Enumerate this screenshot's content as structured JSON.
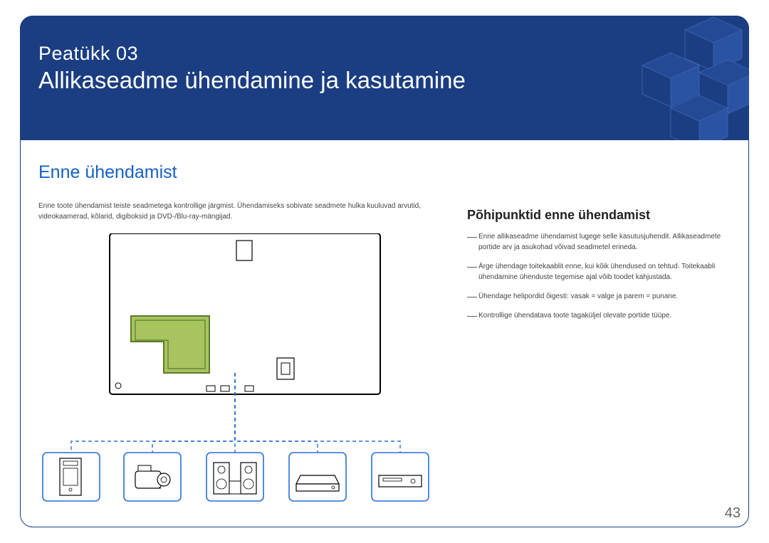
{
  "chapter": {
    "label": "Peatükk 03",
    "title": "Allikaseadme ühendamine ja kasutamine"
  },
  "section_heading": "Enne ühendamist",
  "intro": "Enne toote ühendamist teiste seadmetega kontrollige järgmist. Ühendamiseks sobivate seadmete hulka kuuluvad arvutid, videokaamerad, kõlarid, digiboksid ja DVD-/Blu-ray-mängijad.",
  "right_heading": "Põhipunktid enne ühendamist",
  "bullets": [
    "Enne allikaseadme ühendamist lugege selle kasutusjuhendit. Allikaseadmete portide arv ja asukohad võivad seadmetel erineda.",
    "Ärge ühendage toitekaablit enne, kui kõik ühendused on tehtud. Toitekaabli ühendamine ühenduste tegemise ajal võib toodet kahjustada.",
    "Ühendage helipordid õigesti: vasak = valge ja parem = punane.",
    "Kontrollige ühendatava toote tagaküljel olevate portide tüüpe."
  ],
  "page_number": "43"
}
